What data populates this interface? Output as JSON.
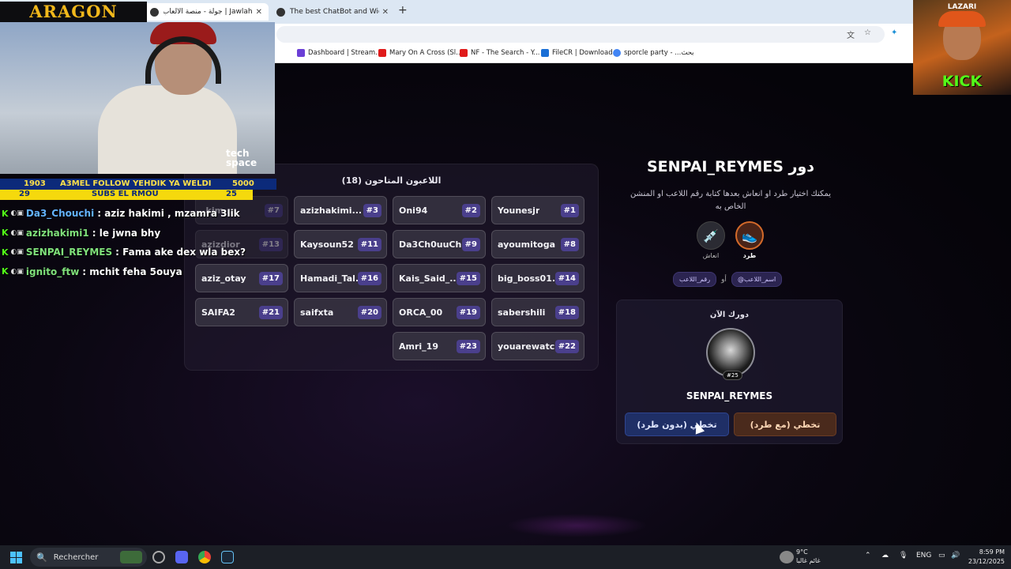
{
  "browser": {
    "tabs": [
      {
        "title": "Jawlah | جولة - منصة الألعاب التر"
      },
      {
        "title": "The best ChatBot and Widgets"
      }
    ],
    "new_tab": "+",
    "bookmarks": [
      {
        "label": "Dashboard | Stream...",
        "color": "#6b3fd6"
      },
      {
        "label": "Mary On A Cross (Sl...",
        "color": "#e01b1b"
      },
      {
        "label": "NF - The Search - Y...",
        "color": "#e01b1b"
      },
      {
        "label": "FileCR | Download",
        "color": "#1a6fd6"
      },
      {
        "label": "sporcle party - ...بحث",
        "color": "#4285f4"
      }
    ]
  },
  "game": {
    "panel_title": "اللاعبون المتاحون (18)",
    "players": [
      {
        "name": "Younesjr",
        "num": "#1"
      },
      {
        "name": "Oni94",
        "num": "#2"
      },
      {
        "name": "azizhakimi...",
        "num": "#3"
      },
      {
        "name": "_kim...",
        "num": "#7"
      },
      {
        "name": "ayoumitoga",
        "num": "#8"
      },
      {
        "name": "Da3Ch0uuCh...",
        "num": "#9"
      },
      {
        "name": "Kaysoun52",
        "num": "#11"
      },
      {
        "name": "azizdior",
        "num": "#13"
      },
      {
        "name": "big_boss01...",
        "num": "#14"
      },
      {
        "name": "Kais_Said_...",
        "num": "#15"
      },
      {
        "name": "Hamadi_Tal...",
        "num": "#16"
      },
      {
        "name": "aziz_otay",
        "num": "#17"
      },
      {
        "name": "sabershili",
        "num": "#18"
      },
      {
        "name": "ORCA_00",
        "num": "#19"
      },
      {
        "name": "saifxta",
        "num": "#20"
      },
      {
        "name": "SAIFA2",
        "num": "#21"
      },
      {
        "name": "youarewatc...",
        "num": "#22"
      },
      {
        "name": "Amri_19",
        "num": "#23"
      }
    ],
    "turn_title": "دور SENPAI_REYMES",
    "turn_desc": "يمكنك اختيار طرد او انعاش بعدها كتابة رقم اللاعب او المنشن الخاص به",
    "action_kick": "طرد",
    "action_revive": "انعاش",
    "chip_name": "@اسم_اللاعب",
    "chip_or": "أو",
    "chip_number": "رقم_اللاعب",
    "now_label": "دورك الآن",
    "current_player": "SENPAI_REYMES",
    "current_number": "#25",
    "skip_no_kick": "تخطي (بدون طرد)",
    "skip_with_kick": "تخطي (مع طرد)"
  },
  "overlay": {
    "brand": "ARAGON",
    "cam_logo": "tech space",
    "ticker_left": "1903",
    "ticker_text": "A3MEL FOLLOW YEHDIK YA WELDI",
    "ticker_right": "5000",
    "subs_left": "29",
    "subs_text": "SUBS EL RMOU",
    "subs_right": "25",
    "chat": [
      {
        "user": "Da3_Chouchi",
        "color": "#63b3ff",
        "message": ": aziz hakimi , mzamra 3lik"
      },
      {
        "user": "azizhakimi1",
        "color": "#7fe07a",
        "message": ": le jwna bhy"
      },
      {
        "user": "SENPAI_REYMES",
        "color": "#7fe07a",
        "message": ": Fama ake dex wla bex?"
      },
      {
        "user": "ignito_ftw",
        "color": "#7fe07a",
        "message": ": mchit feha 5ouya"
      }
    ],
    "kick_top": "LAZARI",
    "kick_brand": "KICK"
  },
  "taskbar": {
    "search_placeholder": "Rechercher",
    "weather_temp": "9°C",
    "weather_desc": "غائم غالبا",
    "lang": "ENG",
    "time": "8:59 PM",
    "date": "23/12/2025"
  }
}
